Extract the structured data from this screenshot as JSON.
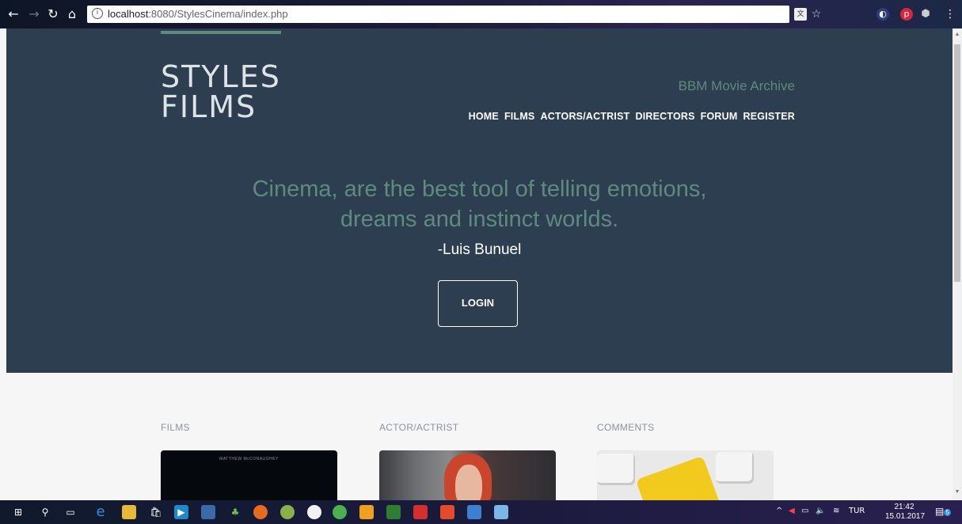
{
  "browser": {
    "url_host": "localhost",
    "url_path": ":8080/StylesCinema/index.php"
  },
  "site": {
    "logo_line1": "STYLES",
    "logo_line2": "FILMS",
    "subtitle": "BBM Movie Archive",
    "menu": [
      "HOME",
      "FILMS",
      "ACTORS/ACTRIST",
      "DIRECTORS",
      "FORUM",
      "REGISTER"
    ],
    "quote_line1": "Cinema, are the best tool of telling emotions,",
    "quote_line2": "dreams and instinct worlds.",
    "author": "-Luis Bunuel",
    "login_label": "LOGIN"
  },
  "sections": [
    {
      "label": "FILMS",
      "thumb_text": "MATTHEW McCONAUGHEY"
    },
    {
      "label": "ACTOR/ACTRIST"
    },
    {
      "label": "COMMENTS"
    }
  ],
  "taskbar": {
    "language": "TUR",
    "time": "21:42",
    "date": "15.01.2017",
    "notification_count": "5"
  },
  "colors": {
    "hero_bg": "#2c3e50",
    "accent": "#5f8a80"
  }
}
